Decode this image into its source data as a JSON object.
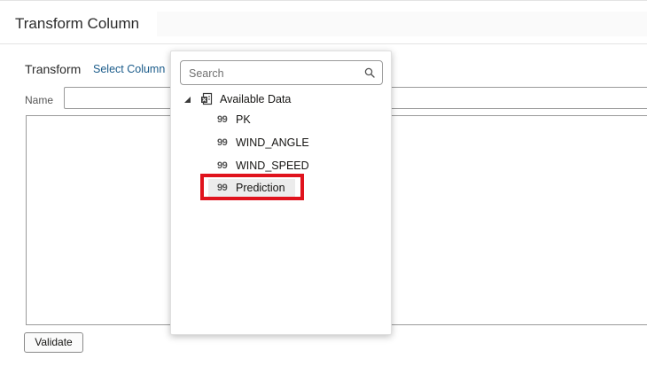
{
  "header": {
    "title": "Transform Column"
  },
  "form": {
    "transform_label": "Transform",
    "select_column_link": "Select Column",
    "name_label": "Name",
    "name_value": "",
    "validate_label": "Validate"
  },
  "popup": {
    "search": {
      "placeholder": "Search",
      "value": ""
    },
    "tree": {
      "root_label": "Available Data",
      "expanded": true,
      "items": [
        {
          "type_glyph": "99",
          "label": "PK",
          "selected": false
        },
        {
          "type_glyph": "99",
          "label": "WIND_ANGLE",
          "selected": false
        },
        {
          "type_glyph": "99",
          "label": "WIND_SPEED",
          "selected": false
        },
        {
          "type_glyph": "99",
          "label": "Prediction",
          "selected": true
        }
      ]
    }
  },
  "colors": {
    "link": "#1a5b8a",
    "highlight": "#e0131d",
    "selected_bg": "#ececec"
  },
  "icons": {
    "search": "search-icon",
    "tree_toggle": "triangle-expanded-icon",
    "dataset": "dataset-icon"
  }
}
